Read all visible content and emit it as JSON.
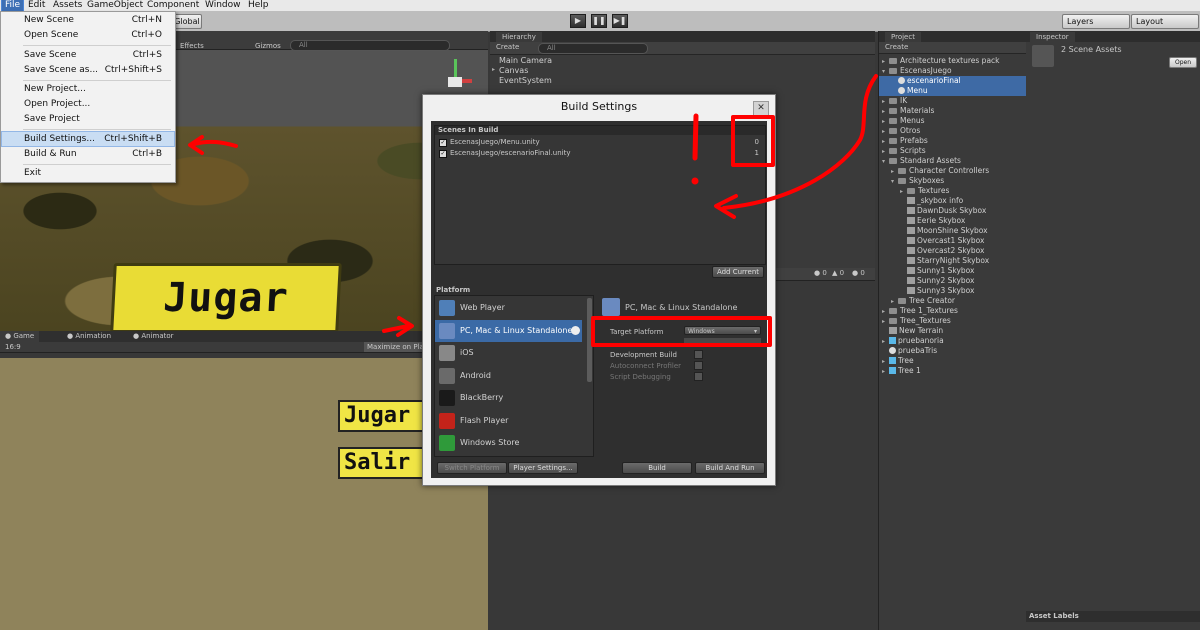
{
  "menubar": {
    "items": [
      "File",
      "Edit",
      "Assets",
      "GameObject",
      "Component",
      "Window",
      "Help"
    ]
  },
  "toolbar": {
    "global_label": "Global",
    "layers_label": "Layers",
    "layout_label": "Layout",
    "effects_label": "Effects",
    "gizmos_label": "Gizmos",
    "all_placeholder": "All"
  },
  "file_menu": {
    "items": [
      {
        "label": "New Scene",
        "shortcut": "Ctrl+N"
      },
      {
        "label": "Open Scene",
        "shortcut": "Ctrl+O"
      },
      {
        "label": "Save Scene",
        "shortcut": "Ctrl+S"
      },
      {
        "label": "Save Scene as...",
        "shortcut": "Ctrl+Shift+S"
      },
      {
        "label": "New Project...",
        "shortcut": ""
      },
      {
        "label": "Open Project...",
        "shortcut": ""
      },
      {
        "label": "Save Project",
        "shortcut": ""
      },
      {
        "label": "Build Settings...",
        "shortcut": "Ctrl+Shift+B"
      },
      {
        "label": "Build & Run",
        "shortcut": "Ctrl+B"
      },
      {
        "label": "Exit",
        "shortcut": ""
      }
    ]
  },
  "scene": {
    "jugar_text": "Jugar"
  },
  "game": {
    "tabs": [
      "Game",
      "Animation",
      "Animator"
    ],
    "aspect": "16:9",
    "maximize_label": "Maximize on Play",
    "jugar_text": "Jugar",
    "salir_text": "Salir"
  },
  "hierarchy": {
    "tab": "Hierarchy",
    "create_label": "Create",
    "search_placeholder": "All",
    "items": [
      "Main Camera",
      "Canvas",
      "EventSystem"
    ],
    "console_counts": [
      "0",
      "0",
      "0"
    ]
  },
  "project": {
    "tab": "Project",
    "create_label": "Create",
    "items": [
      {
        "label": "Architecture textures pack",
        "icon": "folder",
        "indent": 0,
        "tri": "▸"
      },
      {
        "label": "EscenasJuego",
        "icon": "folder",
        "indent": 0,
        "tri": "▾"
      },
      {
        "label": "escenarioFinal",
        "icon": "unity",
        "indent": 1,
        "tri": "",
        "selected": true
      },
      {
        "label": "Menu",
        "icon": "unity",
        "indent": 1,
        "tri": "",
        "selected": true
      },
      {
        "label": "IK",
        "icon": "folder",
        "indent": 0,
        "tri": "▸"
      },
      {
        "label": "Materials",
        "icon": "folder",
        "indent": 0,
        "tri": "▸"
      },
      {
        "label": "Menus",
        "icon": "folder",
        "indent": 0,
        "tri": "▸"
      },
      {
        "label": "Otros",
        "icon": "folder",
        "indent": 0,
        "tri": "▸"
      },
      {
        "label": "Prefabs",
        "icon": "folder",
        "indent": 0,
        "tri": "▸"
      },
      {
        "label": "Scripts",
        "icon": "folder",
        "indent": 0,
        "tri": "▸"
      },
      {
        "label": "Standard Assets",
        "icon": "folder",
        "indent": 0,
        "tri": "▾"
      },
      {
        "label": "Character Controllers",
        "icon": "folder",
        "indent": 1,
        "tri": "▸"
      },
      {
        "label": "Skyboxes",
        "icon": "folder",
        "indent": 1,
        "tri": "▾"
      },
      {
        "label": "Textures",
        "icon": "folder",
        "indent": 2,
        "tri": "▸"
      },
      {
        "label": "_skybox info",
        "icon": "texture",
        "indent": 2,
        "tri": ""
      },
      {
        "label": "DawnDusk Skybox",
        "icon": "texture",
        "indent": 2,
        "tri": ""
      },
      {
        "label": "Eerie Skybox",
        "icon": "texture",
        "indent": 2,
        "tri": ""
      },
      {
        "label": "MoonShine Skybox",
        "icon": "texture",
        "indent": 2,
        "tri": ""
      },
      {
        "label": "Overcast1 Skybox",
        "icon": "texture",
        "indent": 2,
        "tri": ""
      },
      {
        "label": "Overcast2 Skybox",
        "icon": "texture",
        "indent": 2,
        "tri": ""
      },
      {
        "label": "StarryNight Skybox",
        "icon": "texture",
        "indent": 2,
        "tri": ""
      },
      {
        "label": "Sunny1 Skybox",
        "icon": "texture",
        "indent": 2,
        "tri": ""
      },
      {
        "label": "Sunny2 Skybox",
        "icon": "texture",
        "indent": 2,
        "tri": ""
      },
      {
        "label": "Sunny3 Skybox",
        "icon": "texture",
        "indent": 2,
        "tri": ""
      },
      {
        "label": "Tree Creator",
        "icon": "folder",
        "indent": 1,
        "tri": "▸"
      },
      {
        "label": "Tree 1_Textures",
        "icon": "folder",
        "indent": 0,
        "tri": "▸"
      },
      {
        "label": "Tree_Textures",
        "icon": "folder",
        "indent": 0,
        "tri": "▸"
      },
      {
        "label": "New Terrain",
        "icon": "texture",
        "indent": 0,
        "tri": ""
      },
      {
        "label": "pruebanoria",
        "icon": "cube",
        "indent": 0,
        "tri": "▸"
      },
      {
        "label": "pruebaTris",
        "icon": "unity",
        "indent": 0,
        "tri": ""
      },
      {
        "label": "Tree",
        "icon": "cube",
        "indent": 0,
        "tri": "▸"
      },
      {
        "label": "Tree 1",
        "icon": "cube",
        "indent": 0,
        "tri": "▸"
      }
    ]
  },
  "inspector": {
    "tab": "Inspector",
    "title": "2 Scene Assets",
    "open_label": "Open",
    "asset_labels": "Asset Labels"
  },
  "build_settings": {
    "title": "Build Settings",
    "scenes_header": "Scenes In Build",
    "scenes": [
      {
        "path": "EscenasJuego/Menu.unity",
        "index": "0"
      },
      {
        "path": "EscenasJuego/escenarioFinal.unity",
        "index": "1"
      }
    ],
    "add_current": "Add Current",
    "platform_header": "Platform",
    "platforms": [
      {
        "label": "Web Player",
        "color": "#4f7fb8"
      },
      {
        "label": "PC, Mac & Linux Standalone",
        "color": "#6a8ac0",
        "selected": true
      },
      {
        "label": "iOS",
        "color": "#888888"
      },
      {
        "label": "Android",
        "color": "#6a6a6a"
      },
      {
        "label": "BlackBerry",
        "color": "#1a1a1a"
      },
      {
        "label": "Flash Player",
        "color": "#c3231a"
      },
      {
        "label": "Windows Store",
        "color": "#2f9a3a"
      }
    ],
    "selected_platform": "PC, Mac & Linux Standalone",
    "target_platform_label": "Target Platform",
    "target_platform_value": "Windows",
    "options": [
      "Development Build",
      "Autoconnect Profiler",
      "Script Debugging"
    ],
    "switch_platform": "Switch Platform",
    "player_settings": "Player Settings...",
    "build": "Build",
    "build_and_run": "Build And Run"
  },
  "colors": {
    "annotation_red": "#ff0000",
    "selection_blue": "#3b6aa6"
  }
}
